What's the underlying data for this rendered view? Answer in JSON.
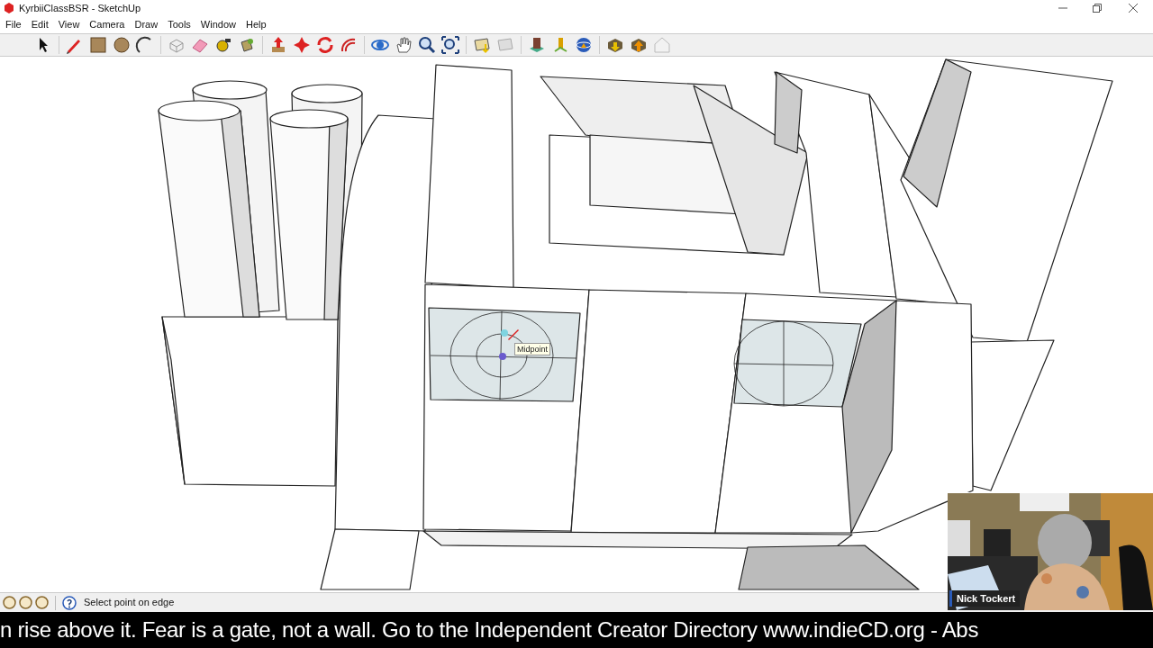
{
  "window": {
    "title": "KyrbiiClassBSR - SketchUp"
  },
  "menu": [
    "File",
    "Edit",
    "View",
    "Camera",
    "Draw",
    "Tools",
    "Window",
    "Help"
  ],
  "viewport": {
    "tooltip": "Midpoint"
  },
  "webcam": {
    "kind": "picture",
    "name": "Nick Tockert"
  },
  "status_bar": {
    "message": "Select point on edge"
  },
  "ticker": "n rise above it. Fear is a gate, not a wall. Go to the Independent Creator Directory www.indieCD.org - Abs"
}
